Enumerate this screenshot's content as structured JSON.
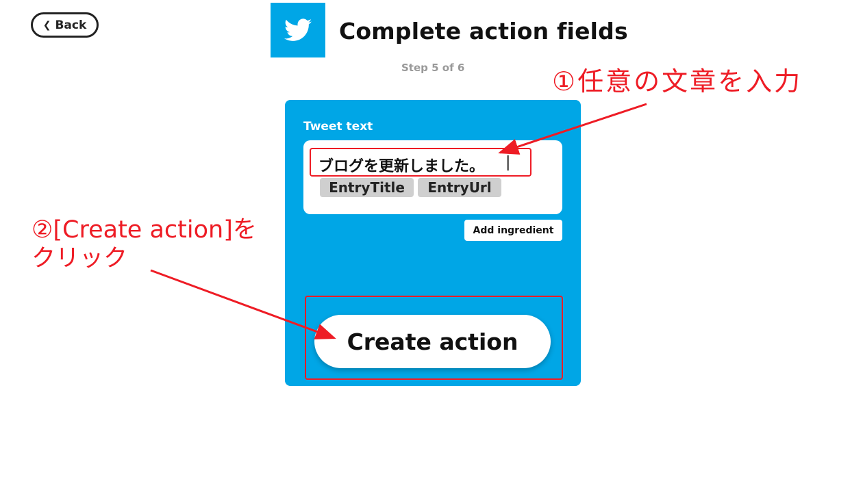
{
  "header": {
    "back_label": "Back",
    "title": "Complete action fields",
    "step": "Step 5 of 6",
    "service_icon": "twitter-bird-icon"
  },
  "form": {
    "field_label": "Tweet text",
    "tweet_value": "ブログを更新しました。",
    "ingredients": [
      "EntryTitle",
      "EntryUrl"
    ],
    "add_ingredient_label": "Add ingredient",
    "submit_label": "Create action"
  },
  "annotations": {
    "step1": "①任意の文章を入力",
    "step2": "②[Create action]をクリック"
  },
  "colors": {
    "brand": "#00A6E6",
    "annotation": "#EE1C25"
  }
}
